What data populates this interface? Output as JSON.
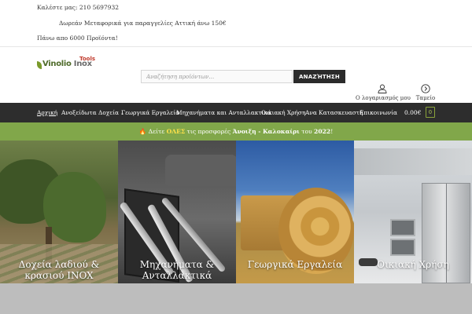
{
  "topbar": {
    "phone": "Καλέστε μας: 210 5697932",
    "shipping": "Δωρεάν Μεταφορικά για παραγγελίες Αττική άνω 150€",
    "products": "Πάνω απο 6000 Προϊόντα!"
  },
  "brand": {
    "name_main": "Vinolio",
    "name_inox": "Inox",
    "name_tools": "Tools"
  },
  "search": {
    "placeholder": "Αναζήτηση προϊόντων…",
    "button_label": "ΑΝΑΖΉΤΗΣΗ"
  },
  "header_links": {
    "account": "Ο λογαριασμός μου",
    "cart": "Ταμείο"
  },
  "nav": {
    "items": [
      {
        "label": "Αρχική"
      },
      {
        "label": "Ανοξείδωτα Δοχεία"
      },
      {
        "label": "Γεωργικά Εργαλεία"
      },
      {
        "label": "Μηχανήματα και Ανταλλακτικά"
      },
      {
        "label": "Οικιακή Χρήση"
      },
      {
        "label": "Ανα Κατασκευαστή"
      },
      {
        "label": "Επικοινωνία"
      }
    ],
    "cart_total": "0.00€",
    "cart_count": "0"
  },
  "promo": {
    "icon": "🔥",
    "text_before": " Δείτε ",
    "highlight": "ΟΛΕΣ",
    "text_middle": " τις προσφορές ",
    "season": "Άνοιξη - Καλοκαίρι",
    "text_after": " του ",
    "year": "2022",
    "end": "!"
  },
  "categories": [
    {
      "title": "Δοχεία λαδιού & κρασιού INOX"
    },
    {
      "title": "Μηχανήματα & Ανταλλακτικά"
    },
    {
      "title": "Γεωργικά Εργαλεία"
    },
    {
      "title": "Οικιακή Χρήση"
    }
  ],
  "colors": {
    "nav_bg": "#2d2d2d",
    "promo_bg": "#81a74a",
    "accent_green": "#7a9a2b"
  }
}
